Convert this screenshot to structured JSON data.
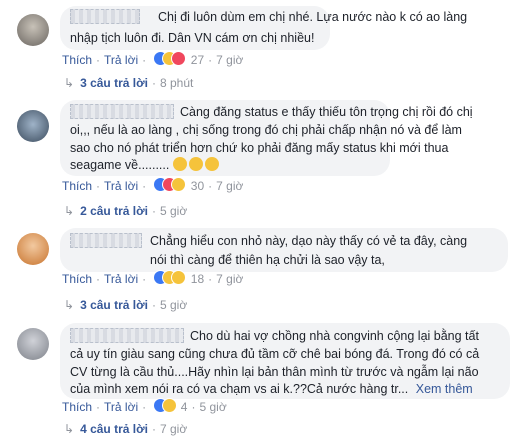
{
  "comments": [
    {
      "text_line1": "Chị đi luôn dùm em chị nhé. Lựa nước nào k có ao làng",
      "text_line2": "nhập tịch luôn đi. Dân VN cám ơn chị nhiều!",
      "like": "Thích",
      "reply": "Trả lời",
      "reaction_count": "27",
      "time": "7 giờ",
      "replies_label": "3 câu trả lời",
      "replies_time": "8 phút"
    },
    {
      "text_line1": "Càng đăng status e thấy thiếu tôn trọng chị rồi đó chị",
      "text_line2": "oi,,, nếu là ao làng , chị sống trong đó chị phải chấp nhận nó và để làm",
      "text_line3": "sao cho nó phát triển hơn chứ ko phải đăng mấy status khi mới thua",
      "text_line4": "seagame về.........",
      "like": "Thích",
      "reply": "Trả lời",
      "reaction_count": "30",
      "time": "7 giờ",
      "replies_label": "2 câu trả lời",
      "replies_time": "5 giờ"
    },
    {
      "text_line1": "Chẳng hiểu con nhỏ này, dạo này thấy có vẻ ta đây, càng",
      "text_line2": "nói thì càng để thiên hạ chửi là sao vậy ta,",
      "like": "Thích",
      "reply": "Trả lời",
      "reaction_count": "18",
      "time": "7 giờ",
      "replies_label": "3 câu trả lời",
      "replies_time": "5 giờ"
    },
    {
      "text_line1": "Cho dù hai vợ chồng nhà congvinh cộng lại bằng tất",
      "text_line2": "cả uy tín giàu sang cũng chưa đủ tầm cỡ chê bai bóng đá. Trong đó có cả",
      "text_line3": "CV từng là cầu thủ....Hãy nhìn lại bản thân mình từ trước và ngẫm lại não",
      "text_line4": "của mình xem nói ra có va chạm vs ai k.??Cả nước hàng tr...",
      "see_more": "Xem thêm",
      "like": "Thích",
      "reply": "Trả lời",
      "reaction_count": "4",
      "time": "5 giờ",
      "replies_label": "4 câu trả lời",
      "replies_time": "7 giờ"
    }
  ],
  "colors": {
    "link": "#365899",
    "muted": "#90949c",
    "bubble": "#f2f3f5"
  },
  "icons": [
    "reply-arrow-icon",
    "like-reaction-icon",
    "haha-reaction-icon",
    "love-reaction-icon",
    "wow-reaction-icon",
    "laugh-emoji-icon"
  ]
}
